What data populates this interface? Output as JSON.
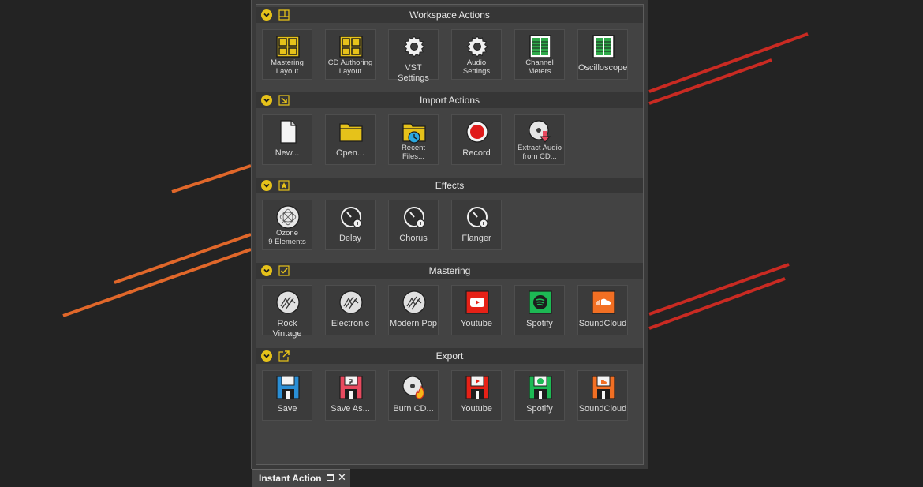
{
  "panel_title": "Instant Action",
  "colors": {
    "accent": "#e6c21a",
    "orange": "#e0672a",
    "red": "#c92a22"
  },
  "sections": [
    {
      "title": "Workspace Actions",
      "header_icon": "layout-icon",
      "tiles": [
        {
          "label": "Mastering Layout",
          "lines": [
            "Mastering",
            "Layout"
          ],
          "icon": "layout-grid-icon"
        },
        {
          "label": "CD Authoring Layout",
          "lines": [
            "CD Authoring",
            "Layout"
          ],
          "icon": "layout-grid-icon"
        },
        {
          "label": "VST Settings",
          "lines": [
            "VST Settings"
          ],
          "icon": "gear-icon"
        },
        {
          "label": "Audio Settings",
          "lines": [
            "Audio",
            "Settings"
          ],
          "icon": "gear-icon"
        },
        {
          "label": "Channel Meters",
          "lines": [
            "Channel",
            "Meters"
          ],
          "icon": "meter-icon"
        },
        {
          "label": "Oscilloscope",
          "lines": [
            "Oscilloscope"
          ],
          "icon": "meter-icon"
        }
      ]
    },
    {
      "title": "Import Actions",
      "header_icon": "import-arrow-icon",
      "tiles": [
        {
          "label": "New...",
          "lines": [
            "New..."
          ],
          "icon": "new-document-icon"
        },
        {
          "label": "Open...",
          "lines": [
            "Open..."
          ],
          "icon": "folder-icon"
        },
        {
          "label": "Recent Files...",
          "lines": [
            "Recent",
            "Files..."
          ],
          "icon": "recent-folder-icon"
        },
        {
          "label": "Record",
          "lines": [
            "Record"
          ],
          "icon": "record-icon"
        },
        {
          "label": "Extract Audio from CD...",
          "lines": [
            "Extract Audio",
            "from CD..."
          ],
          "icon": "cd-extract-icon"
        }
      ]
    },
    {
      "title": "Effects",
      "header_icon": "star-icon",
      "tiles": [
        {
          "label": "Ozone 9 Elements",
          "lines": [
            "Ozone",
            "9 Elements"
          ],
          "icon": "ozone-icon"
        },
        {
          "label": "Delay",
          "lines": [
            "Delay"
          ],
          "icon": "knob-icon"
        },
        {
          "label": "Chorus",
          "lines": [
            "Chorus"
          ],
          "icon": "knob-icon"
        },
        {
          "label": "Flanger",
          "lines": [
            "Flanger"
          ],
          "icon": "knob-icon"
        }
      ]
    },
    {
      "title": "Mastering",
      "header_icon": "checkbox-icon",
      "tiles": [
        {
          "label": "Rock Vintage",
          "lines": [
            "Rock Vintage"
          ],
          "icon": "mastering-preset-icon"
        },
        {
          "label": "Electronic",
          "lines": [
            "Electronic"
          ],
          "icon": "mastering-preset-icon"
        },
        {
          "label": "Modern Pop",
          "lines": [
            "Modern Pop"
          ],
          "icon": "mastering-preset-icon"
        },
        {
          "label": "Youtube",
          "lines": [
            "Youtube"
          ],
          "icon": "youtube-icon"
        },
        {
          "label": "Spotify",
          "lines": [
            "Spotify"
          ],
          "icon": "spotify-icon"
        },
        {
          "label": "SoundCloud",
          "lines": [
            "SoundCloud"
          ],
          "icon": "soundcloud-icon"
        }
      ]
    },
    {
      "title": "Export",
      "header_icon": "export-arrow-icon",
      "tiles": [
        {
          "label": "Save",
          "lines": [
            "Save"
          ],
          "icon": "save-floppy-icon"
        },
        {
          "label": "Save As...",
          "lines": [
            "Save As..."
          ],
          "icon": "save-as-floppy-icon"
        },
        {
          "label": "Burn CD...",
          "lines": [
            "Burn CD..."
          ],
          "icon": "burn-cd-icon"
        },
        {
          "label": "Youtube",
          "lines": [
            "Youtube"
          ],
          "icon": "youtube-export-icon"
        },
        {
          "label": "Spotify",
          "lines": [
            "Spotify"
          ],
          "icon": "spotify-export-icon"
        },
        {
          "label": "SoundCloud",
          "lines": [
            "SoundCloud"
          ],
          "icon": "soundcloud-export-icon"
        }
      ]
    }
  ]
}
